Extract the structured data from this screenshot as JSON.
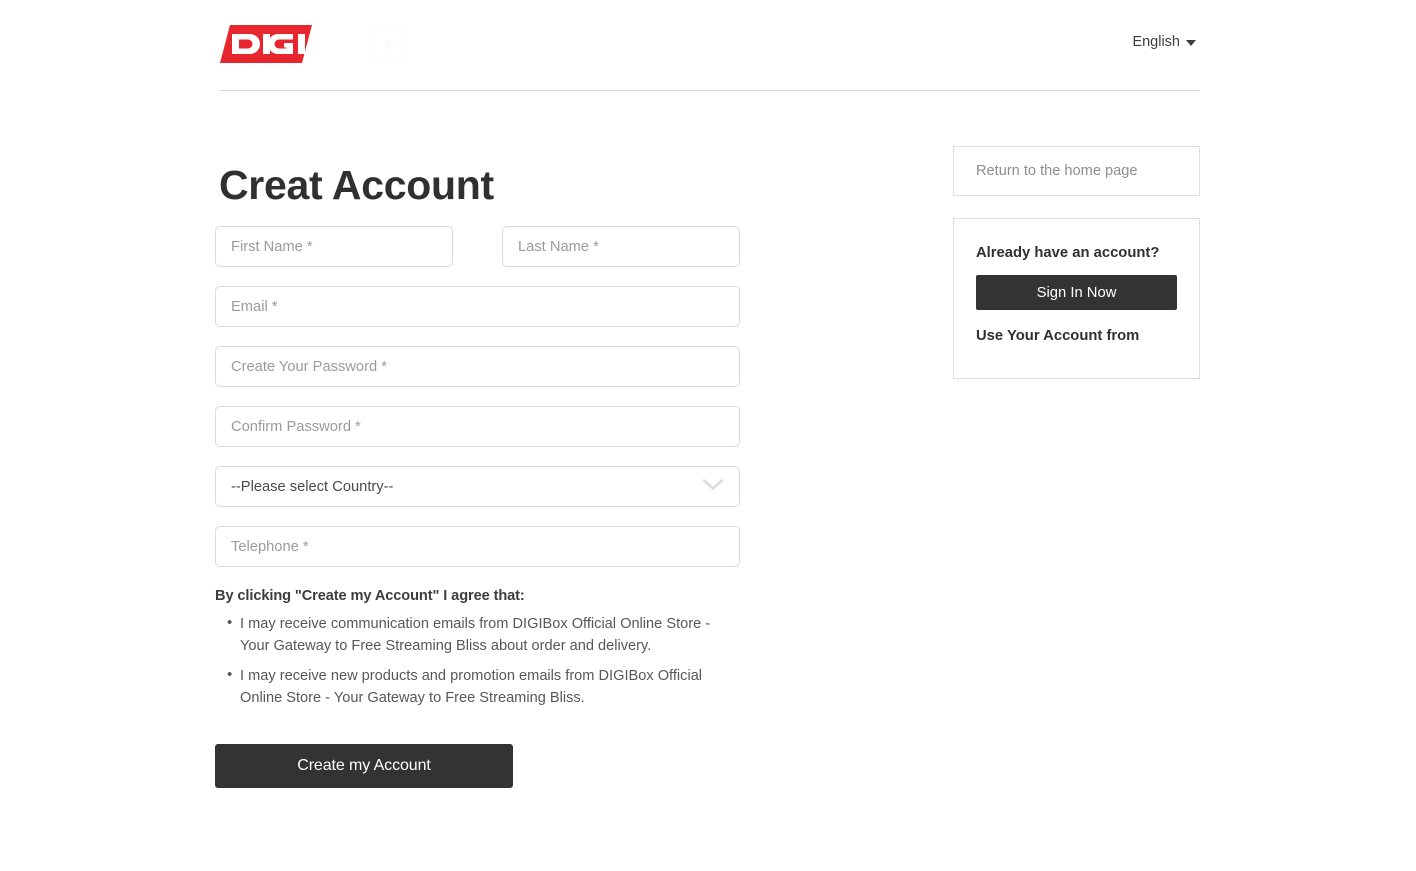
{
  "header": {
    "logo_text": "DIGI",
    "logo_color": "#E8262D",
    "language_label": "English",
    "caret_icon": "chevron-down-icon",
    "broken_image_icon": "play-thumbnail-icon"
  },
  "page": {
    "title": "Creat Account"
  },
  "form": {
    "first_name_placeholder": "First Name *",
    "last_name_placeholder": "Last Name *",
    "email_placeholder": "Email *",
    "password_placeholder": "Create Your Password *",
    "confirm_password_placeholder": "Confirm Password *",
    "country_selected": "--Please select Country--",
    "country_chevron_icon": "chevron-down-icon",
    "telephone_placeholder": "Telephone *",
    "submit_label": "Create my Account"
  },
  "agreement": {
    "title": "By clicking \"Create my Account\" I agree that:",
    "items": [
      "I may receive communication emails from DIGIBox Official Online Store - Your Gateway to Free Streaming Bliss about order and delivery.",
      "I may receive new products and promotion emails from DIGIBox Official Online Store - Your Gateway to Free Streaming Bliss."
    ]
  },
  "sidebar": {
    "return_home_label": "Return to the home page",
    "already_account_label": "Already have an account?",
    "sign_in_label": "Sign In Now",
    "use_account_label": "Use Your Account from"
  },
  "colors": {
    "accent_red": "#E8262D",
    "button_dark": "#333333",
    "border_gray": "#d9dcdd",
    "placeholder_gray": "#9b9b9b"
  }
}
